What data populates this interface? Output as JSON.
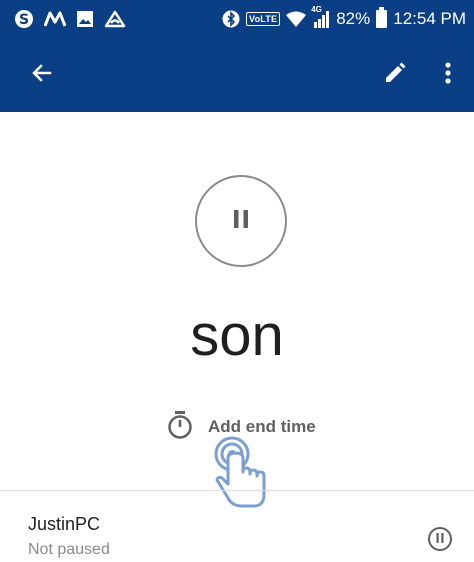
{
  "status_bar": {
    "left_icons": [
      "shazam-icon",
      "maps-m-icon",
      "image-icon",
      "app-notification-icon"
    ],
    "volte_label": "VoLTE",
    "network_label": "4G",
    "battery_percent": "82%",
    "time": "12:54 PM"
  },
  "toolbar": {
    "back_icon": "arrow-back-icon",
    "edit_icon": "pencil-icon",
    "more_icon": "more-vert-icon"
  },
  "profile": {
    "name": "son",
    "end_time_label": "Add end time"
  },
  "devices": [
    {
      "name": "JustinPC",
      "status": "Not paused"
    }
  ],
  "colors": {
    "primary": "#0b3f85",
    "text": "#212121",
    "secondary_text": "#8a8a8a",
    "touch_indicator": "#7a9fd0"
  }
}
